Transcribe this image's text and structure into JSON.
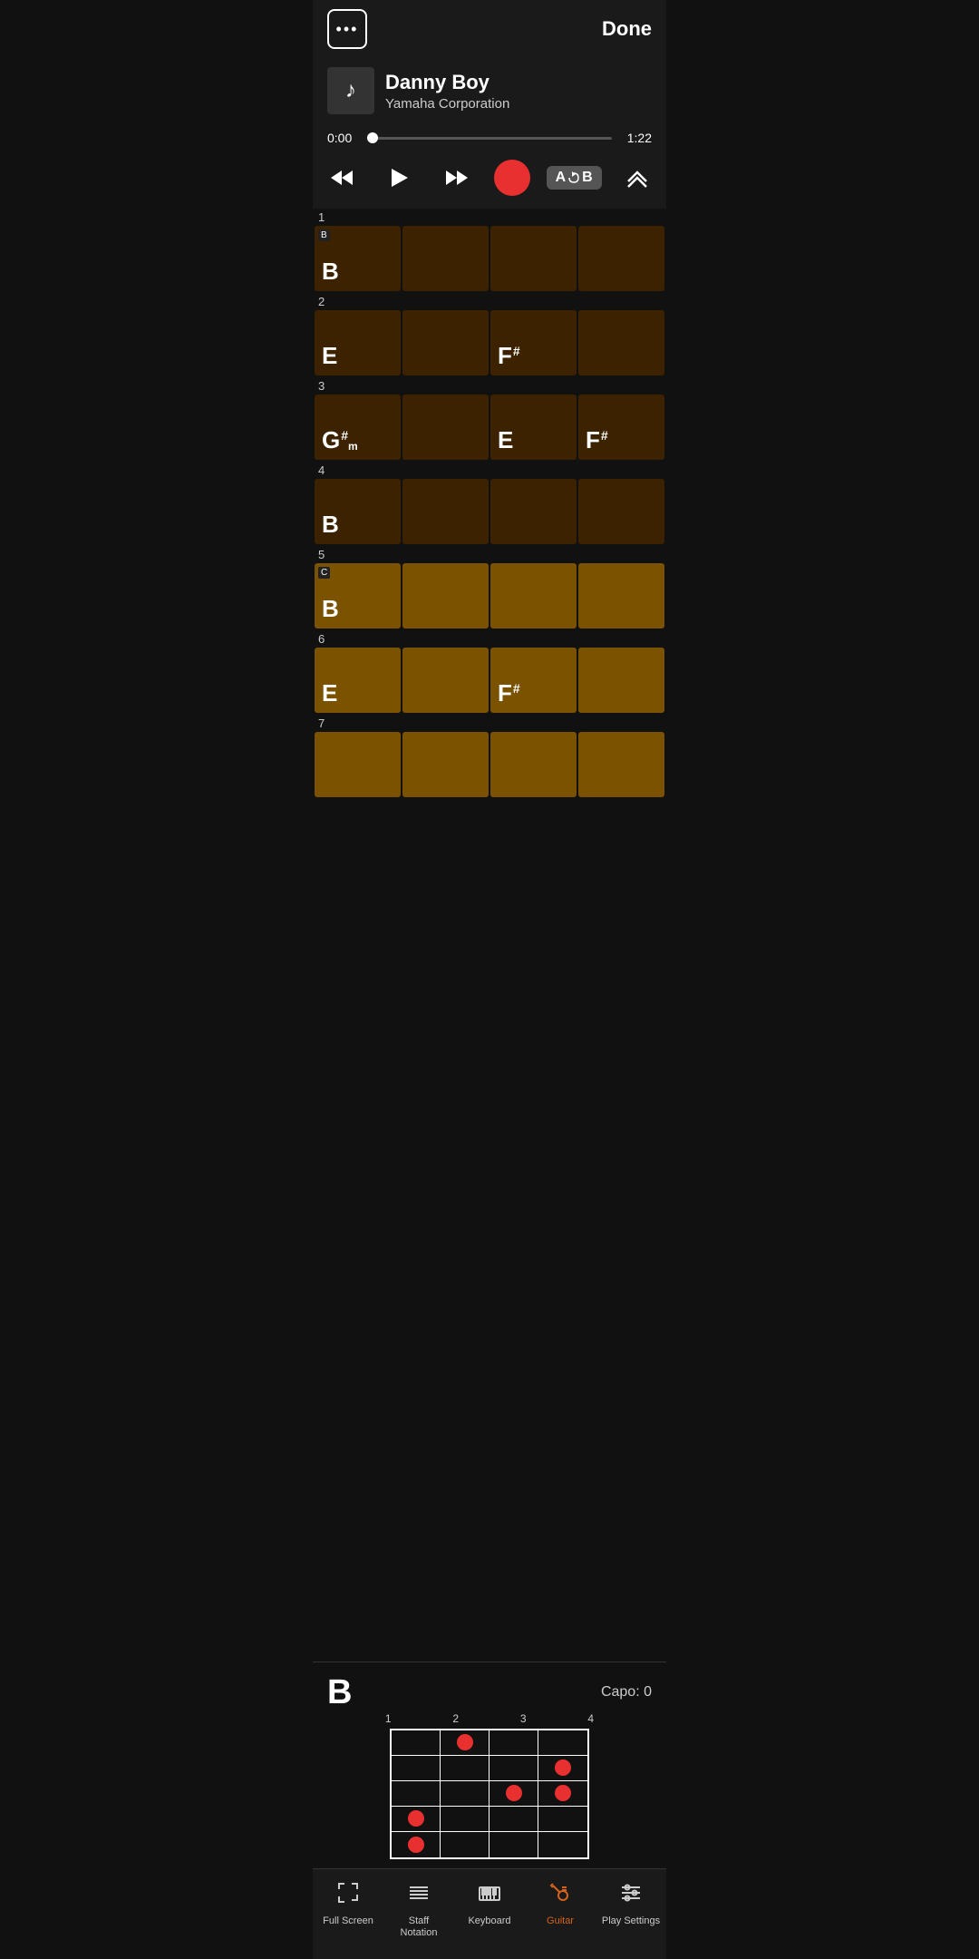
{
  "header": {
    "menu_label": "•••",
    "done_label": "Done"
  },
  "song": {
    "title": "Danny Boy",
    "artist": "Yamaha Corporation",
    "music_note": "♪"
  },
  "playback": {
    "time_current": "0:00",
    "time_total": "1:22",
    "progress_percent": 0
  },
  "controls": {
    "rewind": "⏮",
    "play": "▶",
    "fast_forward": "⏭",
    "record_label": "record",
    "ab_label": "A↺B",
    "up_label": "⋀"
  },
  "capo_display": "Capo: 0",
  "chord_diagram": {
    "chord_name": "B",
    "capo": "Capo: 0",
    "fret_numbers": [
      "1",
      "2",
      "3",
      "4"
    ],
    "dots": [
      {
        "row": 0,
        "col": 1
      },
      {
        "row": 1,
        "col": 3
      },
      {
        "row": 2,
        "col": 3
      },
      {
        "row": 2,
        "col": 2
      },
      {
        "row": 3,
        "col": 0
      },
      {
        "row": 4,
        "col": 0
      }
    ]
  },
  "measures": [
    {
      "number": "1",
      "cells": [
        {
          "label": "B",
          "modifier": "",
          "sub": "",
          "style": "dark-brown",
          "capo": "B"
        },
        {
          "label": "",
          "modifier": "",
          "sub": "",
          "style": "dark-brown"
        },
        {
          "label": "",
          "modifier": "",
          "sub": "",
          "style": "dark-brown"
        },
        {
          "label": "",
          "modifier": "",
          "sub": "",
          "style": "dark-brown"
        }
      ]
    },
    {
      "number": "2",
      "cells": [
        {
          "label": "E",
          "modifier": "",
          "sub": "",
          "style": "dark-brown"
        },
        {
          "label": "",
          "modifier": "",
          "sub": "",
          "style": "dark-brown"
        },
        {
          "label": "F",
          "modifier": "#",
          "sub": "",
          "style": "dark-brown"
        },
        {
          "label": "",
          "modifier": "",
          "sub": "",
          "style": "dark-brown"
        }
      ]
    },
    {
      "number": "3",
      "cells": [
        {
          "label": "G",
          "modifier": "#",
          "sub": "m",
          "style": "dark-brown"
        },
        {
          "label": "",
          "modifier": "",
          "sub": "",
          "style": "dark-brown"
        },
        {
          "label": "E",
          "modifier": "",
          "sub": "",
          "style": "dark-brown"
        },
        {
          "label": "F",
          "modifier": "#",
          "sub": "",
          "style": "dark-brown"
        }
      ]
    },
    {
      "number": "4",
      "cells": [
        {
          "label": "B",
          "modifier": "",
          "sub": "",
          "style": "dark-brown"
        },
        {
          "label": "",
          "modifier": "",
          "sub": "",
          "style": "dark-brown"
        },
        {
          "label": "",
          "modifier": "",
          "sub": "",
          "style": "dark-brown"
        },
        {
          "label": "",
          "modifier": "",
          "sub": "",
          "style": "dark-brown"
        }
      ]
    },
    {
      "number": "5",
      "cells": [
        {
          "label": "B",
          "modifier": "",
          "sub": "",
          "style": "medium-brown",
          "capo": "C"
        },
        {
          "label": "",
          "modifier": "",
          "sub": "",
          "style": "medium-brown"
        },
        {
          "label": "",
          "modifier": "",
          "sub": "",
          "style": "medium-brown"
        },
        {
          "label": "",
          "modifier": "",
          "sub": "",
          "style": "medium-brown"
        }
      ]
    },
    {
      "number": "6",
      "cells": [
        {
          "label": "E",
          "modifier": "",
          "sub": "",
          "style": "medium-brown"
        },
        {
          "label": "",
          "modifier": "",
          "sub": "",
          "style": "medium-brown"
        },
        {
          "label": "F",
          "modifier": "#",
          "sub": "",
          "style": "medium-brown"
        },
        {
          "label": "",
          "modifier": "",
          "sub": "",
          "style": "medium-brown"
        }
      ]
    },
    {
      "number": "7",
      "cells": [
        {
          "label": "",
          "modifier": "",
          "sub": "",
          "style": "medium-brown"
        },
        {
          "label": "",
          "modifier": "",
          "sub": "",
          "style": "medium-brown"
        },
        {
          "label": "",
          "modifier": "",
          "sub": "",
          "style": "medium-brown"
        },
        {
          "label": "",
          "modifier": "",
          "sub": "",
          "style": "medium-brown"
        }
      ]
    }
  ],
  "bottom_nav": [
    {
      "id": "fullscreen",
      "label": "Full Screen",
      "active": false
    },
    {
      "id": "staff",
      "label": "Staff\nNotation",
      "active": false
    },
    {
      "id": "keyboard",
      "label": "Keyboard",
      "active": false
    },
    {
      "id": "guitar",
      "label": "Guitar",
      "active": true
    },
    {
      "id": "settings",
      "label": "Play Settings",
      "active": false
    }
  ]
}
